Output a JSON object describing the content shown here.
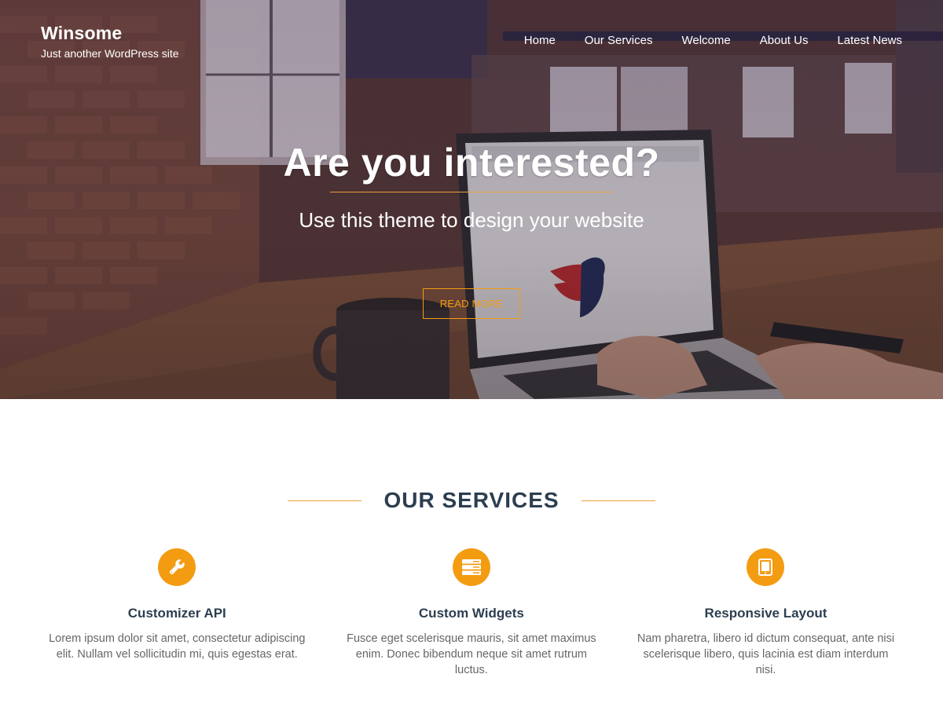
{
  "site": {
    "title": "Winsome",
    "tagline": "Just another WordPress site"
  },
  "nav": {
    "items": [
      {
        "label": "Home"
      },
      {
        "label": "Our Services"
      },
      {
        "label": "Welcome"
      },
      {
        "label": "About Us"
      },
      {
        "label": "Latest News"
      }
    ]
  },
  "hero": {
    "title": "Are you interested?",
    "subtitle": "Use this theme to design your website",
    "button_label": "READ MORE"
  },
  "services": {
    "heading": "OUR SERVICES",
    "items": [
      {
        "icon": "wrench-icon",
        "title": "Customizer API",
        "description": "Lorem ipsum dolor sit amet, consectetur adipiscing elit. Nullam vel sollicitudin mi, quis egestas erat."
      },
      {
        "icon": "server-icon",
        "title": "Custom Widgets",
        "description": "Fusce eget scelerisque mauris, sit amet maximus enim. Donec bibendum neque sit amet rutrum luctus."
      },
      {
        "icon": "tablet-icon",
        "title": "Responsive Layout",
        "description": "Nam pharetra, libero id dictum consequat, ante nisi scelerisque libero, quis lacinia est diam interdum nisi."
      }
    ]
  },
  "colors": {
    "accent": "#f39c12",
    "heading": "#2c3e50",
    "body_text": "#666666",
    "hero_overlay": "#3b2c2e"
  }
}
